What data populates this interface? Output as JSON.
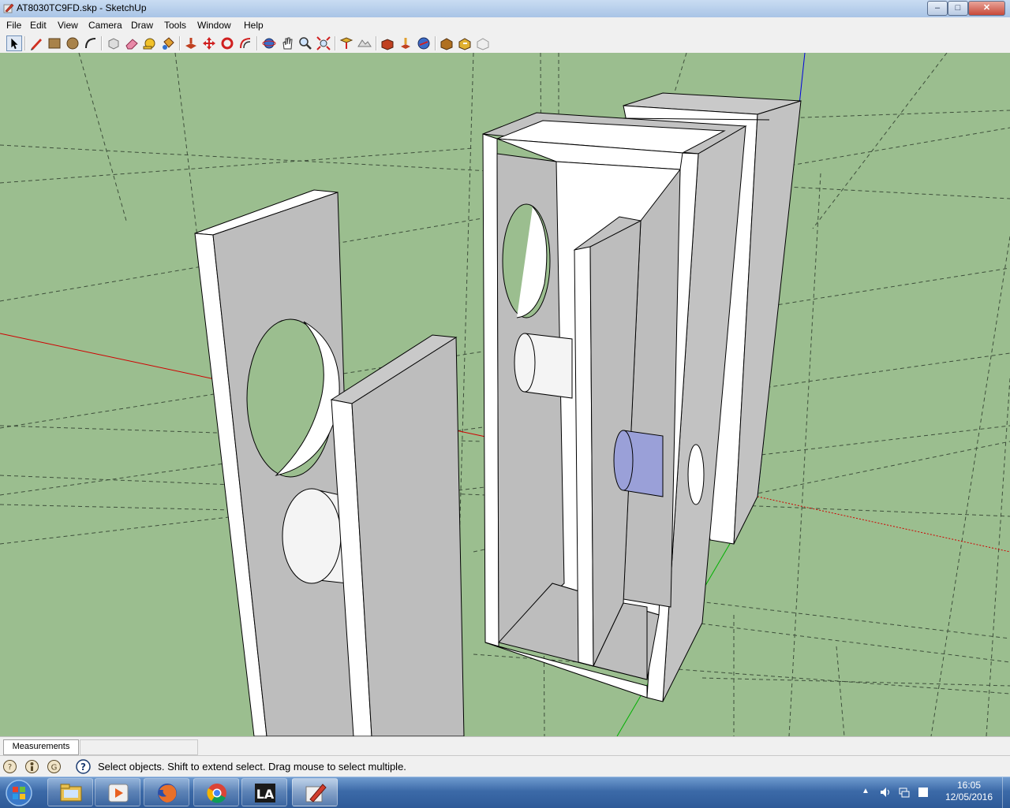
{
  "window": {
    "title": "AT8030TC9FD.skp - SketchUp",
    "controls": {
      "minimize": "–",
      "maximize": "□",
      "close": "✕"
    }
  },
  "menu": [
    "File",
    "Edit",
    "View",
    "Camera",
    "Draw",
    "Tools",
    "Window",
    "Help"
  ],
  "toolbar": {
    "tools": [
      "select-icon",
      "pencil-line-icon",
      "rectangle-icon",
      "circle-icon",
      "arc-icon",
      "make-component-icon",
      "eraser-icon",
      "paint-bucket-icon",
      "tape-measure-icon",
      "push-pull-icon",
      "move-icon",
      "rotate-icon",
      "offset-icon",
      "orbit-icon",
      "pan-icon",
      "zoom-icon",
      "zoom-extents-icon",
      "add-location-icon",
      "toggle-terrain-icon",
      "get-models-icon",
      "share-model-icon",
      "share-component-icon",
      "extension-warehouse-icon",
      "send-to-layout-icon",
      "preview-icon"
    ],
    "selected_tool": "select-icon"
  },
  "measurements": {
    "label": "Measurements",
    "value": ""
  },
  "status": {
    "text": "Select objects. Shift to extend select. Drag mouse to select multiple.",
    "icons": [
      "geo-location-icon",
      "credits-icon",
      "sign-in-icon",
      "help-icon"
    ]
  },
  "taskbar": {
    "apps": [
      "file-explorer-icon",
      "media-player-icon",
      "firefox-icon",
      "chrome-icon",
      "layout-icon",
      "sketchup-icon"
    ],
    "active_app": "sketchup-icon",
    "time": "16:05",
    "date": "12/05/2016"
  },
  "colors": {
    "viewport_background": "#9bbe8f",
    "face_front": "#ffffff",
    "face_back": "#bdbdbd",
    "face_selected": "#9aa0d8",
    "axis_red": "#d00000",
    "axis_green": "#00b000",
    "axis_blue": "#0000e0"
  }
}
